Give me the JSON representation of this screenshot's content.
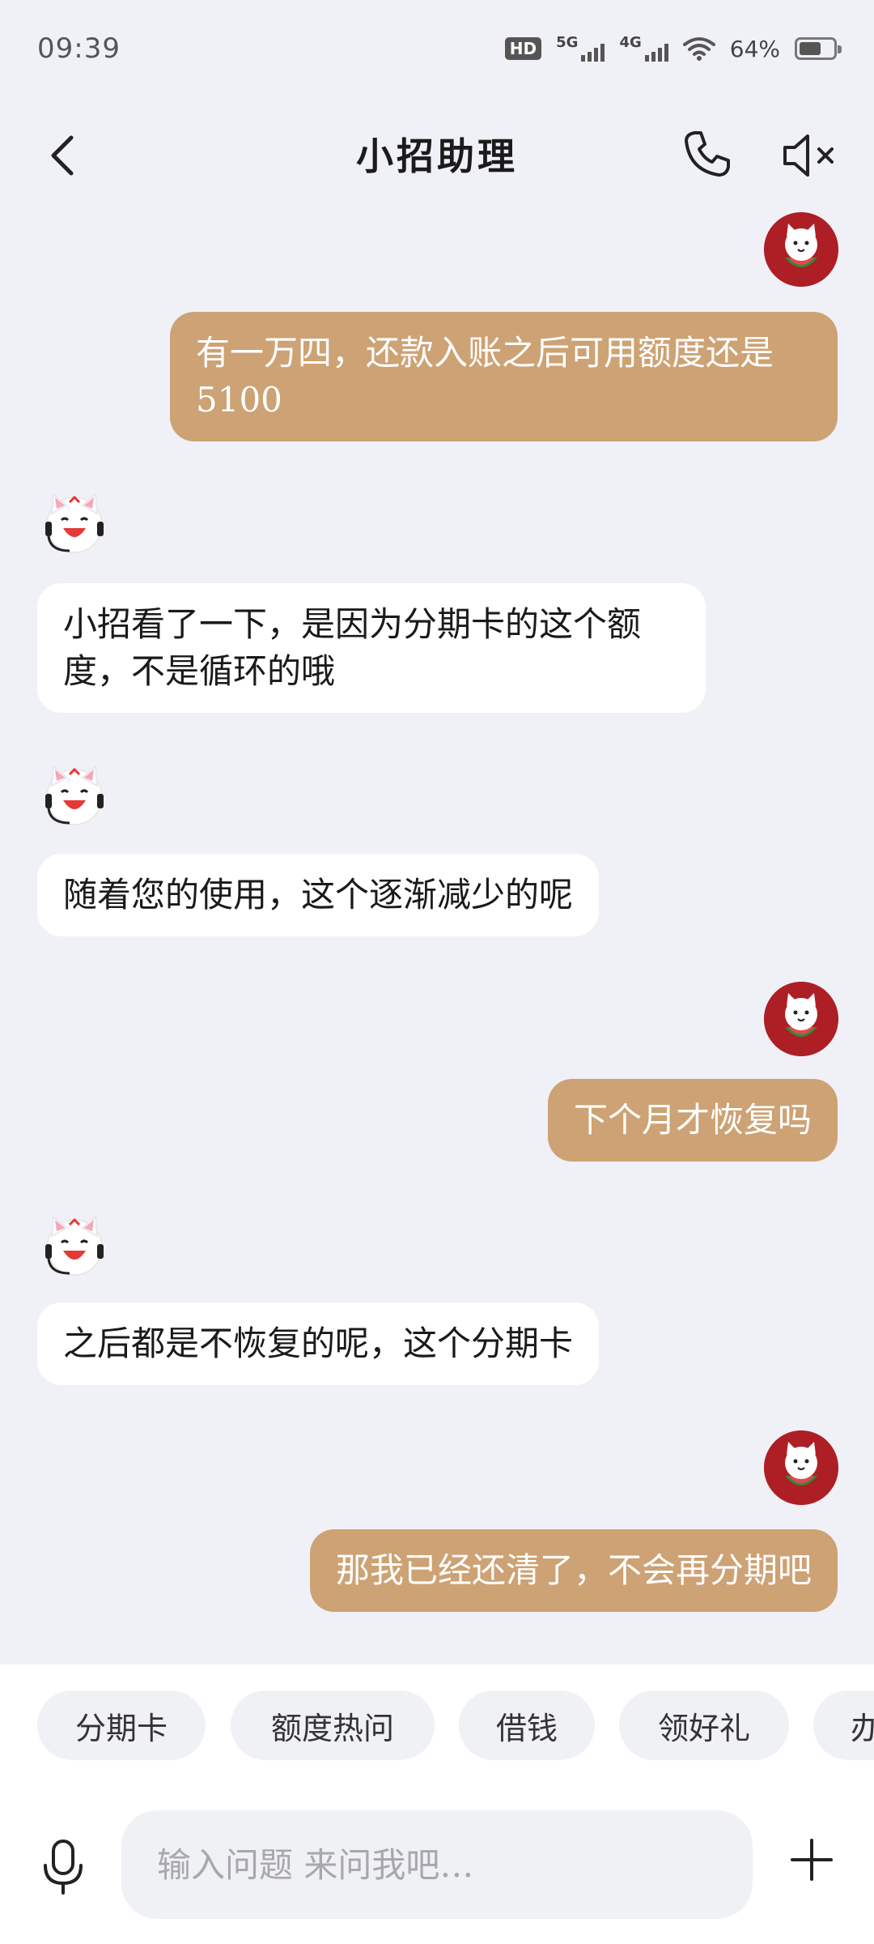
{
  "status_bar": {
    "time": "09:39",
    "hd": "HD",
    "net1": "5G",
    "net2": "4G",
    "battery": "64%",
    "battery_level": 0.64
  },
  "header": {
    "title": "小招助理",
    "back_icon": "chevron-left-icon",
    "call_icon": "phone-icon",
    "mute_icon": "speaker-mute-icon"
  },
  "messages": [
    {
      "sender": "user",
      "text": "有一万四，还款入账之后可用额度还是5100"
    },
    {
      "sender": "bot",
      "text": "小招看了一下，是因为分期卡的这个额度，不是循环的哦"
    },
    {
      "sender": "bot",
      "text": "随着您的使用，这个逐渐减少的呢"
    },
    {
      "sender": "user",
      "text": "下个月才恢复吗"
    },
    {
      "sender": "bot",
      "text": "之后都是不恢复的呢，这个分期卡"
    },
    {
      "sender": "user",
      "text": "那我已经还清了，不会再分期吧"
    }
  ],
  "quick_chips": [
    "分期卡",
    "额度热问",
    "借钱",
    "领好礼",
    "办"
  ],
  "input": {
    "placeholder": "输入问题 来问我吧…",
    "value": ""
  },
  "colors": {
    "background": "#f0f1f7",
    "user_bubble": "#cda274",
    "bot_bubble": "#ffffff",
    "user_avatar": "#ad1f25"
  }
}
